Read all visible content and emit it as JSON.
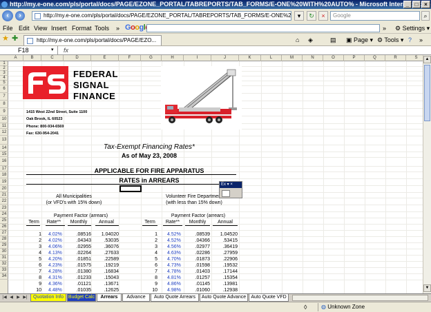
{
  "window": {
    "title": "http://my.e-one.com/pls/portal/docs/PAGE/EZONE_PORTAL/TABREPORTS/TAB_FORMS/E-ONE%20WITH%20AUTO% - Microsoft Internet Explorer p"
  },
  "address": {
    "url": "http://my.e-one.com/pls/portal/docs/PAGE/EZONE_PORTAL/TABREPORTS/TAB_FORMS/E-ONE%20WITH%20/",
    "search_placeholder": "Google"
  },
  "menu": {
    "file": "File",
    "edit": "Edit",
    "view": "View",
    "insert": "Insert",
    "format": "Format",
    "tools": "Tools",
    "google": "Google",
    "settings": "Settings"
  },
  "tabbar": {
    "tab_title": "http://my.e-one.com/pls/portal/docs/PAGE/EZO...",
    "page_label": "Page",
    "tools_label": "Tools"
  },
  "formula": {
    "namebox": "F18",
    "fx": "fx"
  },
  "columns": [
    "A",
    "B",
    "C",
    "D",
    "E",
    "F",
    "G",
    "H",
    "I",
    "J",
    "K",
    "L",
    "M",
    "N",
    "O",
    "P",
    "Q",
    "R",
    "S",
    "T"
  ],
  "rows": [
    "1",
    "2",
    "3",
    "4",
    "5",
    "6",
    "7",
    "8",
    "9",
    "10",
    "11",
    "12",
    "13",
    "14",
    "15",
    "16",
    "17",
    "18",
    "19",
    "20",
    "21",
    "22",
    "23",
    "24",
    "25",
    "26",
    "27",
    "28",
    "29",
    "30",
    "31",
    "32",
    "33",
    "34"
  ],
  "company": {
    "line1": "FEDERAL",
    "line2": "SIGNAL",
    "line3": "FINANCE"
  },
  "address_block": {
    "street": "1415 West 22nd Street, Suite 1100",
    "city": "Oak Brook, IL  60523",
    "phone": "Phone:   800-934-6569",
    "fax": "Fax:       630-954-2041"
  },
  "sheet": {
    "title": "Tax-Exempt Financing Rates*",
    "asof": "As of May 23, 2008",
    "applicable": "APPLICABLE FOR FIRE APPARATUS",
    "rates_in": "RATES in ARREARS",
    "left_group_1": "All Municipalities",
    "left_group_2": "(or VFD's with 15% down)",
    "right_group_1": "Volunteer Fire Department",
    "right_group_2": "(with less than 15% down)",
    "payment_factor": "Payment Factor (arrears)",
    "hdr_term": "Term",
    "hdr_rate": "Rate**",
    "hdr_monthly": "Monthly",
    "hdr_annual": "Annual"
  },
  "left_table": [
    {
      "term": "1",
      "rate": "4.02%",
      "monthly": ".08516",
      "annual": "1.04020"
    },
    {
      "term": "2",
      "rate": "4.02%",
      "monthly": ".04343",
      "annual": ".53035"
    },
    {
      "term": "3",
      "rate": "4.06%",
      "monthly": ".02955",
      "annual": ".36076"
    },
    {
      "term": "4",
      "rate": "4.13%",
      "monthly": ".02264",
      "annual": ".27633"
    },
    {
      "term": "5",
      "rate": "4.20%",
      "monthly": ".01851",
      "annual": ".22589"
    },
    {
      "term": "6",
      "rate": "4.23%",
      "monthly": ".01575",
      "annual": ".19219"
    },
    {
      "term": "7",
      "rate": "4.28%",
      "monthly": ".01380",
      "annual": ".16834"
    },
    {
      "term": "8",
      "rate": "4.31%",
      "monthly": ".01233",
      "annual": ".15043"
    },
    {
      "term": "9",
      "rate": "4.36%",
      "monthly": ".01121",
      "annual": ".13671"
    },
    {
      "term": "10",
      "rate": "4.48%",
      "monthly": ".01035",
      "annual": ".12625"
    }
  ],
  "right_table": [
    {
      "term": "1",
      "rate": "4.52%",
      "monthly": ".08539",
      "annual": "1.04520"
    },
    {
      "term": "2",
      "rate": "4.52%",
      "monthly": ".04366",
      "annual": ".53415"
    },
    {
      "term": "3",
      "rate": "4.56%",
      "monthly": ".02977",
      "annual": ".36419"
    },
    {
      "term": "4",
      "rate": "4.63%",
      "monthly": ".02286",
      "annual": ".27959"
    },
    {
      "term": "5",
      "rate": "4.70%",
      "monthly": ".01873",
      "annual": ".22906"
    },
    {
      "term": "6",
      "rate": "4.73%",
      "monthly": ".01598",
      "annual": ".19532"
    },
    {
      "term": "7",
      "rate": "4.78%",
      "monthly": ".01403",
      "annual": ".17144"
    },
    {
      "term": "8",
      "rate": "4.81%",
      "monthly": ".01257",
      "annual": ".15354"
    },
    {
      "term": "9",
      "rate": "4.86%",
      "monthly": ".01145",
      "annual": ".13981"
    },
    {
      "term": "10",
      "rate": "4.98%",
      "monthly": ".01060",
      "annual": ".12938"
    }
  ],
  "floating_toolbar": {
    "label": "Ex"
  },
  "sheet_tabs": [
    {
      "label": "Quotation Info",
      "bg": "#ffff00",
      "fg": "#1f3fbf"
    },
    {
      "label": "Budget Calc",
      "bg": "#1f3fbf",
      "fg": "#ffff00"
    },
    {
      "label": "Arrears",
      "bg": "#ffffff",
      "fg": "#000000"
    },
    {
      "label": "Advance",
      "bg": "#ffffff",
      "fg": "#000000"
    },
    {
      "label": "Auto Quote Arrears",
      "bg": "#ffffff",
      "fg": "#000000"
    },
    {
      "label": "Auto Quote Advance",
      "bg": "#ffffff",
      "fg": "#000000"
    },
    {
      "label": "Auto Quote VFD",
      "bg": "#ffffff",
      "fg": "#000000"
    }
  ],
  "status": {
    "zone": "Unknown Zone"
  },
  "colors": {
    "logo_red": "#e8202a",
    "rate_blue": "#1f3fbf"
  }
}
